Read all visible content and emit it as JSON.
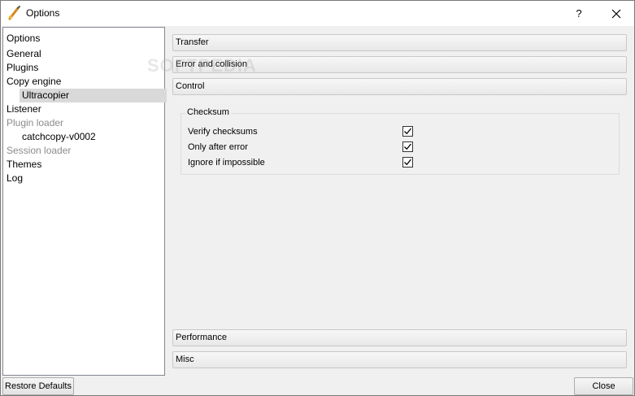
{
  "window": {
    "title": "Options",
    "help_label": "?"
  },
  "tree": {
    "items": [
      {
        "label": "Options",
        "level": 0,
        "disabled": false,
        "selected": false
      },
      {
        "label": "General",
        "level": 0,
        "disabled": false,
        "selected": false
      },
      {
        "label": "Plugins",
        "level": 0,
        "disabled": false,
        "selected": false
      },
      {
        "label": "Copy engine",
        "level": 0,
        "disabled": false,
        "selected": false
      },
      {
        "label": "Ultracopier",
        "level": 1,
        "disabled": false,
        "selected": true
      },
      {
        "label": "Listener",
        "level": 0,
        "disabled": false,
        "selected": false
      },
      {
        "label": "Plugin loader",
        "level": 0,
        "disabled": true,
        "selected": false
      },
      {
        "label": "catchcopy-v0002",
        "level": 1,
        "disabled": false,
        "selected": false
      },
      {
        "label": "Session loader",
        "level": 0,
        "disabled": true,
        "selected": false
      },
      {
        "label": "Themes",
        "level": 0,
        "disabled": false,
        "selected": false
      },
      {
        "label": "Log",
        "level": 0,
        "disabled": false,
        "selected": false
      }
    ]
  },
  "sections": {
    "transfer": "Transfer",
    "error": "Error and collision",
    "control": "Control",
    "performance": "Performance",
    "misc": "Misc"
  },
  "checksum": {
    "title": "Checksum",
    "options": [
      {
        "label": "Verify checksums",
        "checked": true
      },
      {
        "label": "Only after error",
        "checked": true
      },
      {
        "label": "Ignore if impossible",
        "checked": true
      }
    ]
  },
  "buttons": {
    "restore": "Restore Defaults",
    "close": "Close"
  },
  "watermark": "SOFTPEDIA",
  "colors": {
    "selection": "#d9d9d9",
    "disabled_text": "#8c8c8c"
  }
}
